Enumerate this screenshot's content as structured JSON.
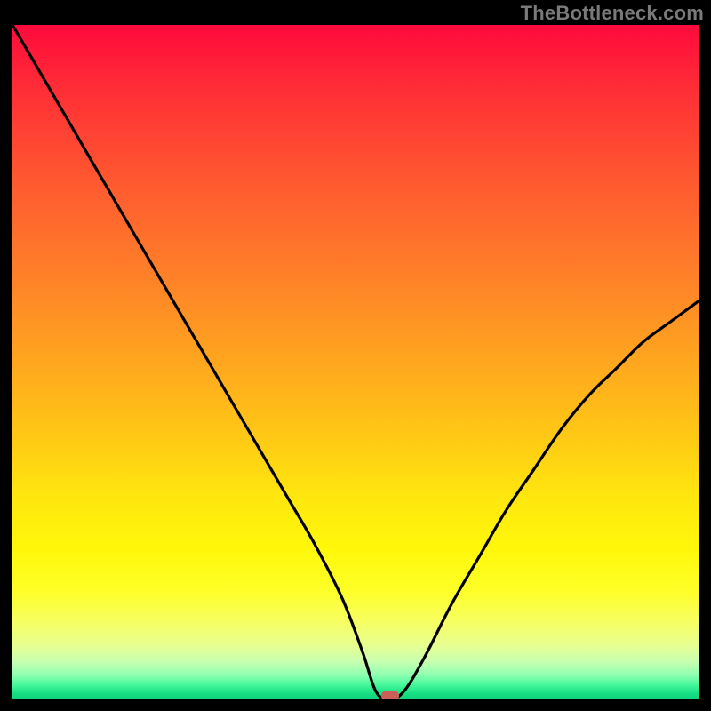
{
  "watermark": "TheBottleneck.com",
  "colors": {
    "frame": "#000000",
    "curve": "#000000",
    "marker": "#cd5f5a"
  },
  "chart_data": {
    "type": "line",
    "title": "",
    "xlabel": "",
    "ylabel": "",
    "xlim": [
      0,
      100
    ],
    "ylim": [
      0,
      100
    ],
    "x": [
      0,
      4,
      8,
      12,
      16,
      20,
      24,
      28,
      32,
      36,
      40,
      44,
      48,
      51,
      53,
      55,
      57,
      60,
      64,
      68,
      72,
      76,
      80,
      84,
      88,
      92,
      96,
      100
    ],
    "values": [
      100,
      93,
      86,
      79,
      72,
      65,
      58,
      51,
      44,
      37,
      30,
      23,
      15,
      7,
      1,
      0,
      1,
      6,
      14,
      21,
      28,
      34,
      40,
      45,
      49,
      53,
      56,
      59
    ],
    "marker": {
      "x": 55,
      "y": 0
    },
    "annotations": []
  }
}
